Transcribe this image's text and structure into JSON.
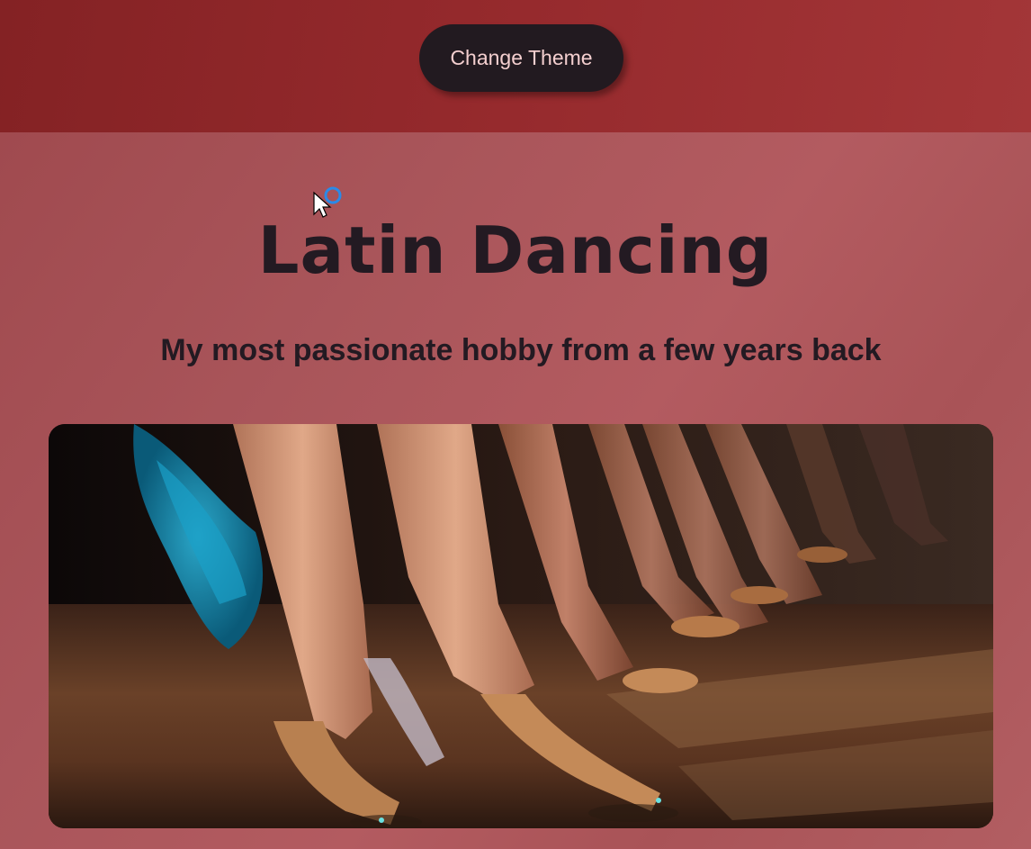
{
  "header": {
    "theme_button_label": "Change Theme"
  },
  "main": {
    "title": "Latin Dancing",
    "subtitle": "My most passionate hobby from a few years back"
  },
  "colors": {
    "header_bg": "#8c2527",
    "main_bg": "#a85256",
    "button_bg": "#221a20",
    "button_text": "#f4cfcf",
    "title_text": "#231a22"
  },
  "icons": {
    "cursor": "mouse-pointer-icon",
    "loading": "busy-ring-icon"
  }
}
